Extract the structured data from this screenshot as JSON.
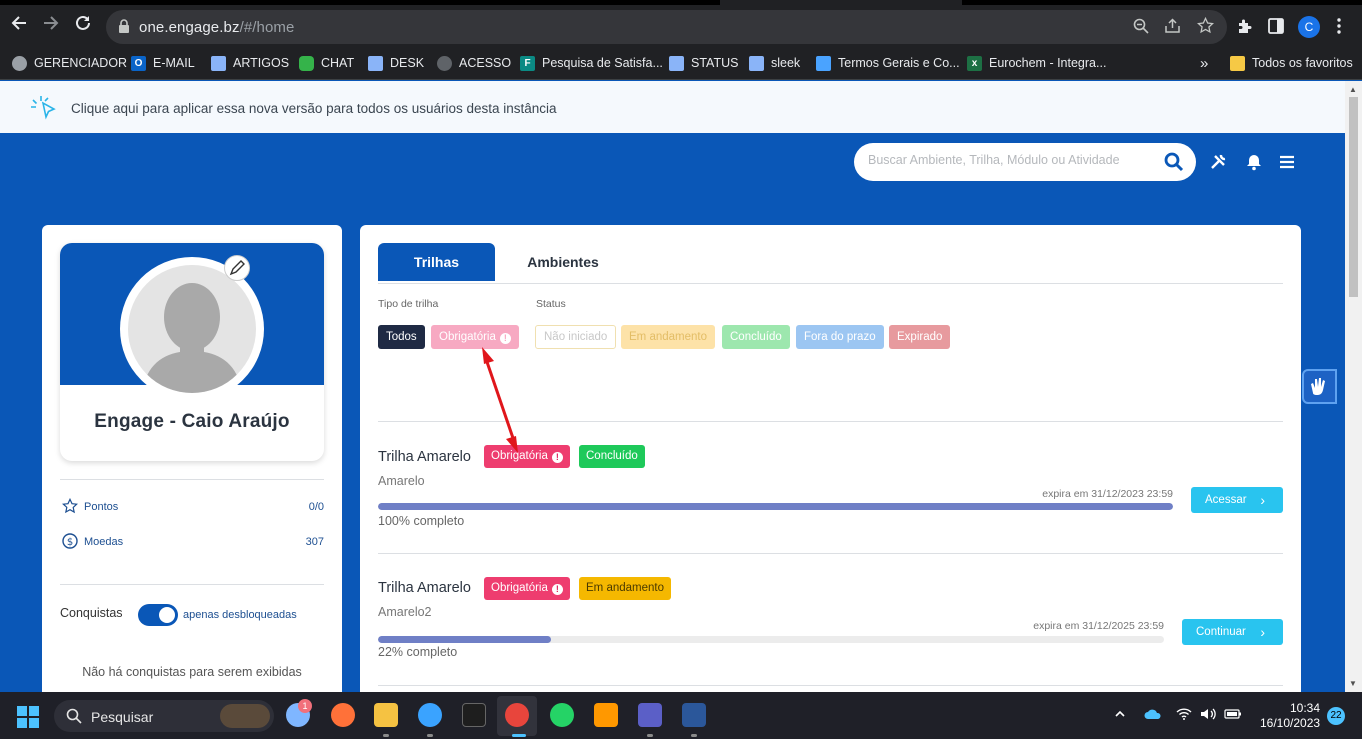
{
  "browser": {
    "url_host": "one.engage.bz",
    "url_path": "/#/home",
    "avatar_letter": "C",
    "bookmarks": [
      {
        "label": "GERENCIADOR",
        "icon": "gear-icon",
        "color": "#9aa0a6"
      },
      {
        "label": "E-MAIL",
        "icon": "outlook-icon",
        "color": "#0a64c8"
      },
      {
        "label": "ARTIGOS",
        "icon": "doc-icon",
        "color": "#8ab4f8"
      },
      {
        "label": "CHAT",
        "icon": "chat-icon",
        "color": "#35b34a"
      },
      {
        "label": "DESK",
        "icon": "doc-icon",
        "color": "#8ab4f8"
      },
      {
        "label": "ACESSO",
        "icon": "globe-icon",
        "color": "#5f6368"
      },
      {
        "label": "Pesquisa de Satisfa...",
        "icon": "forms-icon",
        "color": "#0b8a84"
      },
      {
        "label": "STATUS",
        "icon": "doc-icon",
        "color": "#8ab4f8"
      },
      {
        "label": "sleek",
        "icon": "doc-icon",
        "color": "#8ab4f8"
      },
      {
        "label": "Termos Gerais e Co...",
        "icon": "stripes-icon",
        "color": "#4aa3ff"
      },
      {
        "label": "Eurochem - Integra...",
        "icon": "excel-icon",
        "color": "#1d7044"
      }
    ],
    "more_label": "»",
    "all_favorites": "Todos os favoritos"
  },
  "notice": {
    "text": "Clique aqui para aplicar essa nova versão para todos os usuários desta instância"
  },
  "header": {
    "search_placeholder": "Buscar Ambiente, Trilha, Módulo ou Atividade"
  },
  "profile": {
    "name": "Engage - Caio Araújo",
    "points_label": "Pontos",
    "points_value": "0/0",
    "coins_label": "Moedas",
    "coins_value": "307",
    "achievements_label": "Conquistas",
    "toggle_label": "apenas desbloqueadas",
    "empty_message": "Não há conquistas para serem exibidas"
  },
  "tabs": [
    {
      "label": "Trilhas",
      "active": true
    },
    {
      "label": "Ambientes",
      "active": false
    }
  ],
  "filters": {
    "type_label": "Tipo de trilha",
    "status_label": "Status",
    "type_chips": [
      {
        "label": "Todos",
        "bg": "#1f2a44",
        "fg": "#ffffff"
      },
      {
        "label": "Obrigatória",
        "bg": "#f7a9c2",
        "fg": "#ffffff",
        "excl": true
      }
    ],
    "status_chips": [
      {
        "label": "Não iniciado",
        "bg": "#ffffff",
        "fg": "#c8c8c8",
        "border": "#f0e0b0"
      },
      {
        "label": "Em andamento",
        "bg": "#fde2a8",
        "fg": "#e3bd66"
      },
      {
        "label": "Concluído",
        "bg": "#9de7ae",
        "fg": "#ffffff"
      },
      {
        "label": "Fora do prazo",
        "bg": "#9cc6f2",
        "fg": "#ffffff"
      },
      {
        "label": "Expirado",
        "bg": "#e79a9e",
        "fg": "#ffffff"
      }
    ]
  },
  "trails": [
    {
      "title": "Trilha Amarelo",
      "required_label": "Obrigatória",
      "status_label": "Concluído",
      "status_color": "#1ec95a",
      "subtitle": "Amarelo",
      "expires": "expira em 31/12/2023 23:59",
      "progress": 1.0,
      "progress_text": "100% completo",
      "action_label": "Acessar"
    },
    {
      "title": "Trilha Amarelo",
      "required_label": "Obrigatória",
      "status_label": "Em andamento",
      "status_color": "#f5b800",
      "subtitle": "Amarelo2",
      "expires": "expira em 31/12/2025 23:59",
      "progress": 0.22,
      "progress_text": "22% completo",
      "action_label": "Continuar"
    }
  ],
  "taskbar": {
    "search_label": "Pesquisar",
    "time": "10:34",
    "date": "16/10/2023",
    "notification_count": "22",
    "weather_badge": "1"
  }
}
